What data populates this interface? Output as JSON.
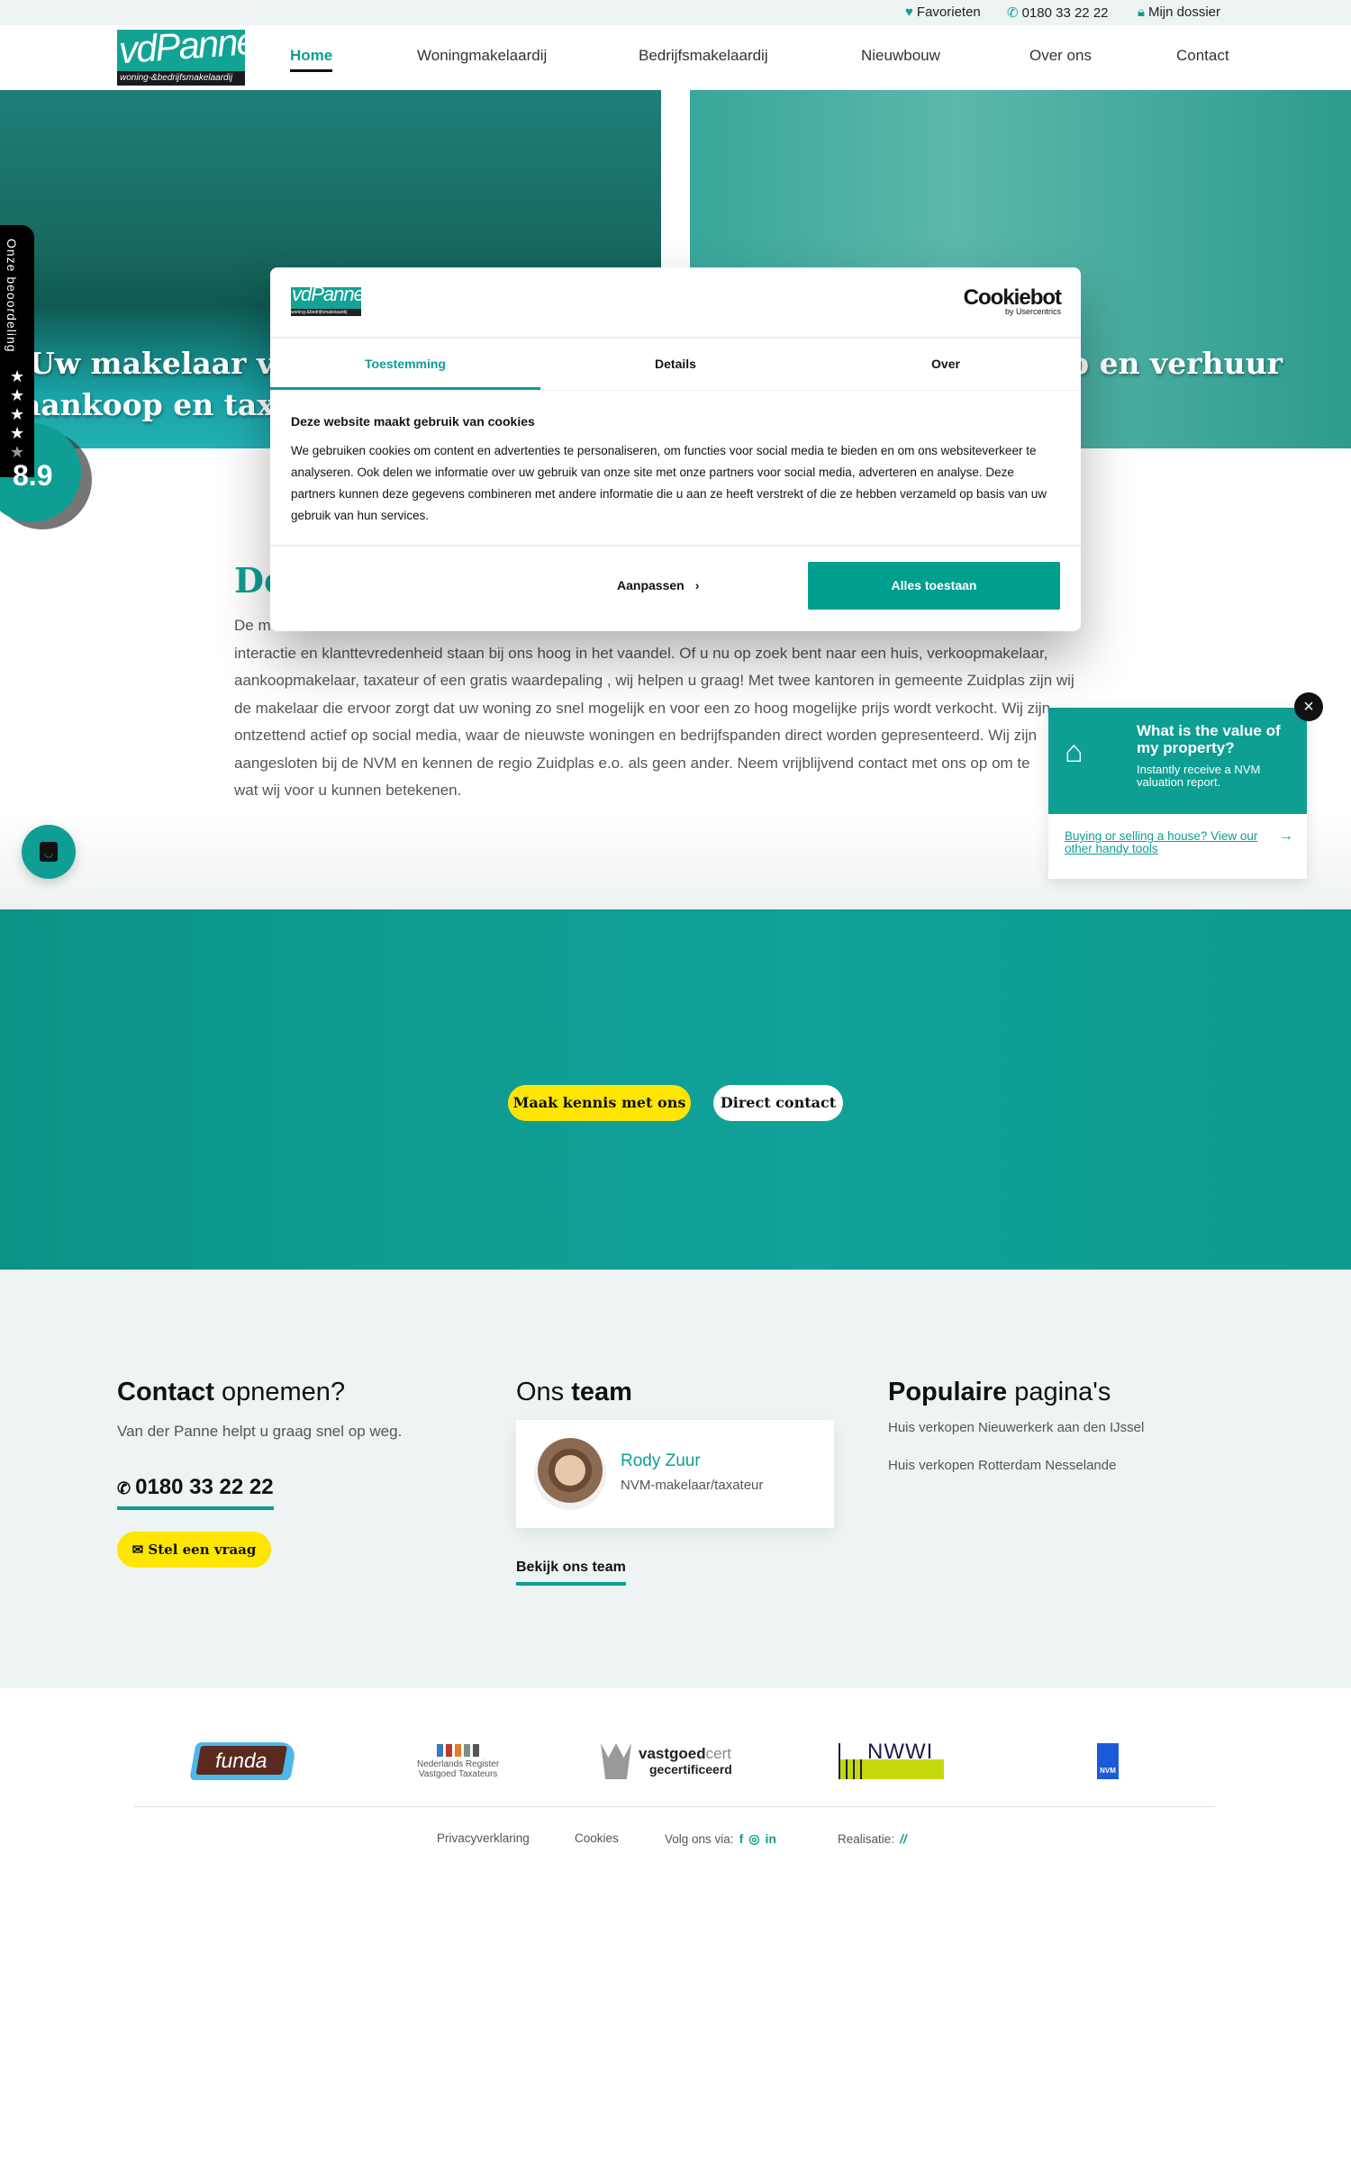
{
  "topbar": {
    "favorites": "Favorieten",
    "phone": "0180 33 22 22",
    "dossier": "Mijn dossier"
  },
  "brand": {
    "logo_main": "vdPanne",
    "logo_sub": "woning-&bedrijfsmakelaardij"
  },
  "nav": {
    "items": [
      {
        "label": "Home",
        "active": true
      },
      {
        "label": "Woningmakelaardij"
      },
      {
        "label": "Bedrijfsmakelaardij"
      },
      {
        "label": "Nieuwbouw"
      },
      {
        "label": "Over ons"
      },
      {
        "label": "Contact"
      }
    ]
  },
  "hero": {
    "left_line1": "Uw makelaar voo",
    "left_line2": "aankoop en taxat",
    "right_line1": "p en verhuur"
  },
  "rating": {
    "label": "Onze beoordeling",
    "score": "8.9",
    "stars": 4.5
  },
  "intro": {
    "heading": "De",
    "lines": [
      "De m",
      "interactie en klanttevredenheid staan bij ons hoog in het vaandel. Of u nu op zoek bent naar een huis, verkoopmakelaar,",
      "aankoopmakelaar, taxateur of een gratis waardepaling , wij helpen u graag! Met twee kantoren in gemeente Zuidplas zijn wij",
      "de makelaar die ervoor zorgt dat uw woning zo snel mogelijk en voor een zo hoog mogelijke prijs wordt verkocht. Wij zijn",
      "ontzettend actief op social media, waar de nieuwste woningen en bedrijfspanden direct worden gepresenteerd. Wij zijn",
      "aangesloten bij de NVM en kennen de regio Zuidplas e.o. als geen ander. Neem vrijblijvend contact met ons op om te",
      "wat wij voor u kunnen betekenen."
    ]
  },
  "cookie": {
    "provider": "Cookiebot",
    "provider_sub": "by Usercentrics",
    "tabs": [
      {
        "label": "Toestemming",
        "active": true
      },
      {
        "label": "Details"
      },
      {
        "label": "Over"
      }
    ],
    "title": "Deze website maakt gebruik van cookies",
    "text": "We gebruiken cookies om content en advertenties te personaliseren, om functies voor social media te bieden en om ons websiteverkeer te analyseren. Ook delen we informatie over uw gebruik van onze site met onze partners voor social media, adverteren en analyse. Deze partners kunnen deze gegevens combineren met andere informatie die u aan ze heeft verstrekt of die ze hebben verzameld op basis van uw gebruik van hun services.",
    "customize": "Aanpassen",
    "allow_all": "Alles toestaan"
  },
  "valuation": {
    "title": "What is the value of my property?",
    "subtitle": "Instantly receive a NVM valuation report.",
    "link": "Buying or selling a house? View our other handy tools"
  },
  "banner": {
    "btn_meet": "Maak kennis met ons",
    "btn_contact": "Direct contact"
  },
  "footer": {
    "contact": {
      "title_bold": "Contact",
      "title_light": " opnemen?",
      "sub": "Van der Panne helpt u graag snel op weg.",
      "phone": "0180 33 22 22",
      "ask": "Stel een vraag"
    },
    "team": {
      "title_light": "Ons ",
      "title_bold": "team",
      "name": "Rody Zuur",
      "role": "NVM-makelaar/taxateur",
      "link": "Bekijk ons team"
    },
    "popular": {
      "title_bold": "Populaire",
      "title_light": " pagina's",
      "links": [
        "Huis verkopen Nieuwerkerk aan den IJssel",
        "Huis verkopen Rotterdam Nesselande"
      ]
    },
    "logos": {
      "funda": "funda",
      "nrvt_1": "Nederlands Register",
      "nrvt_2": "Vastgoed Taxateurs",
      "vgc_1": "vastgoed",
      "vgc_1b": "cert",
      "vgc_2": "gecertificeerd",
      "nwwi": "NWWI",
      "nvm": "NVM"
    },
    "links": {
      "privacy": "Privacyverklaring",
      "cookies": "Cookies",
      "follow": "Volg ons via:",
      "realisatie": "Realisatie:"
    }
  },
  "colors": {
    "accent": "#0e9e93",
    "yellow": "#ffe600"
  }
}
